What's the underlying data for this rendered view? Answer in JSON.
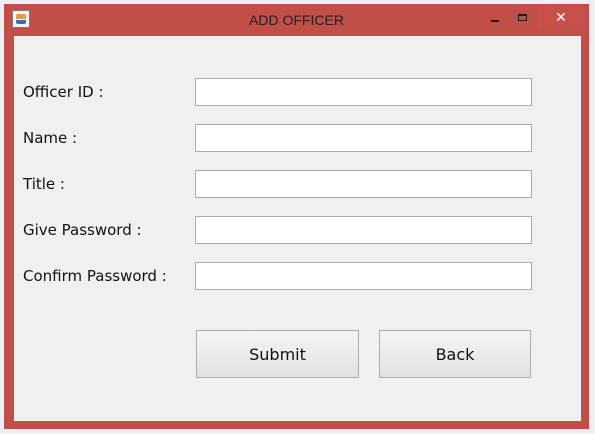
{
  "window": {
    "title": "ADD OFFICER",
    "icon": "java-app-icon",
    "controls": {
      "minimize": "minimize-icon",
      "maximize": "maximize-icon",
      "close": "✕"
    }
  },
  "form": {
    "fields": [
      {
        "label": "Officer ID :",
        "value": ""
      },
      {
        "label": "Name :",
        "value": ""
      },
      {
        "label": "Title :",
        "value": ""
      },
      {
        "label": "Give Password :",
        "value": ""
      },
      {
        "label": "Confirm Password :",
        "value": ""
      }
    ],
    "buttons": {
      "submit": "Submit",
      "back": "Back"
    }
  },
  "colors": {
    "window_frame": "#c14f48",
    "content_background": "#f0f0f0"
  }
}
